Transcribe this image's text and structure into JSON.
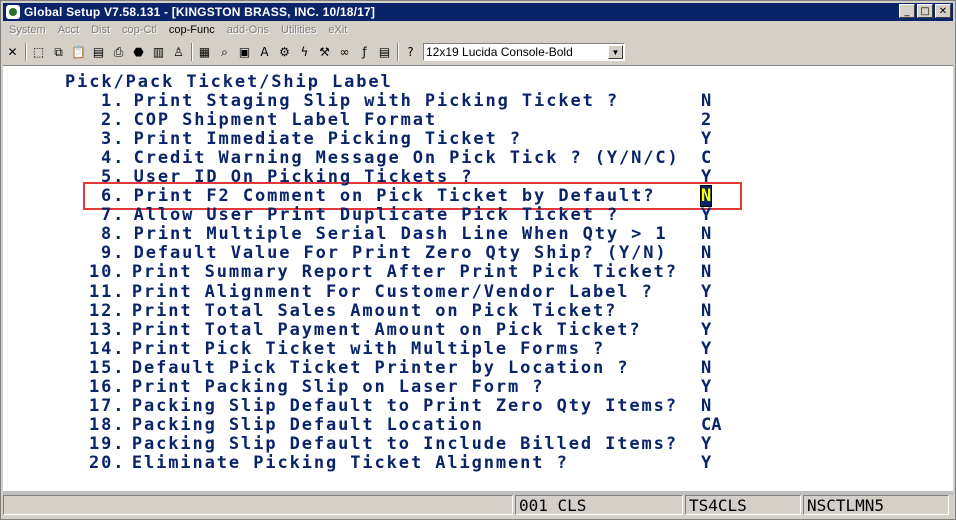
{
  "window": {
    "title": "Global Setup V7.58.131 - [KINGSTON BRASS, INC. 10/18/17]",
    "minimize_glyph": "_",
    "maximize_glyph": "□",
    "close_glyph": "✕"
  },
  "menu": [
    {
      "label": "System",
      "enabled": false
    },
    {
      "label": "Acct",
      "enabled": false
    },
    {
      "label": "Dist",
      "enabled": false
    },
    {
      "label": "cop-Ctl",
      "enabled": false
    },
    {
      "label": "cop-Func",
      "enabled": true
    },
    {
      "label": "add-Ons",
      "enabled": false
    },
    {
      "label": "Utilities",
      "enabled": false
    },
    {
      "label": "eXit",
      "enabled": false
    }
  ],
  "toolbar": {
    "buttons": [
      {
        "icon": "close-icon",
        "glyph": "✕"
      },
      {
        "icon": "select-icon",
        "glyph": "⬚"
      },
      {
        "icon": "copy-icon",
        "glyph": "⧉"
      },
      {
        "icon": "paste-icon",
        "glyph": "📋"
      },
      {
        "icon": "print-icon",
        "glyph": "▤"
      },
      {
        "icon": "printer-setup-icon",
        "glyph": "⎙"
      },
      {
        "icon": "stop-icon",
        "glyph": "⬣"
      },
      {
        "icon": "note-icon",
        "glyph": "▥"
      },
      {
        "icon": "user-icon",
        "glyph": "♙"
      },
      {
        "icon": "print-screen-icon",
        "glyph": "▦"
      },
      {
        "icon": "find-icon",
        "glyph": "⌕"
      },
      {
        "icon": "help-book-icon",
        "glyph": "▣"
      },
      {
        "icon": "font-icon",
        "glyph": "A"
      },
      {
        "icon": "settings-icon",
        "glyph": "⚙"
      },
      {
        "icon": "lightning-icon",
        "glyph": "ϟ"
      },
      {
        "icon": "tools-icon",
        "glyph": "⚒"
      },
      {
        "icon": "link-icon",
        "glyph": "∞"
      },
      {
        "icon": "function-icon",
        "glyph": "ƒ"
      },
      {
        "icon": "document-icon",
        "glyph": "▤"
      },
      {
        "icon": "context-help-icon",
        "glyph": "?"
      }
    ],
    "font_select_value": "12x19 Lucida Console-Bold",
    "font_select_arrow": "▼"
  },
  "screen": {
    "title": "Pick/Pack Ticket/Ship Label",
    "options": [
      {
        "num": "1.",
        "text": "Print Staging Slip with Picking Ticket ?",
        "value": "N"
      },
      {
        "num": "2.",
        "text": "COP Shipment Label Format",
        "value": "2"
      },
      {
        "num": "3.",
        "text": "Print Immediate Picking Ticket ?",
        "value": "Y"
      },
      {
        "num": "4.",
        "text": "Credit Warning Message On Pick Tick ? (Y/N/C)",
        "value": "C"
      },
      {
        "num": "5.",
        "text": "User ID On Picking Tickets ?",
        "value": "Y"
      },
      {
        "num": "6.",
        "text": "Print F2 Comment on Pick Ticket by Default?",
        "value": "N",
        "current": true
      },
      {
        "num": "7.",
        "text": "Allow User Print Duplicate Pick Ticket ?",
        "value": "Y"
      },
      {
        "num": "8.",
        "text": "Print Multiple Serial Dash Line When Qty > 1",
        "value": "N"
      },
      {
        "num": "9.",
        "text": "Default Value For Print Zero Qty Ship? (Y/N)",
        "value": "N"
      },
      {
        "num": "10.",
        "text": "Print Summary Report After Print Pick Ticket?",
        "value": "N"
      },
      {
        "num": "11.",
        "text": "Print Alignment For Customer/Vendor Label ?",
        "value": "Y"
      },
      {
        "num": "12.",
        "text": "Print Total Sales Amount on Pick Ticket?",
        "value": "N"
      },
      {
        "num": "13.",
        "text": "Print Total Payment Amount on Pick Ticket?",
        "value": "Y"
      },
      {
        "num": "14.",
        "text": "Print Pick Ticket with Multiple Forms ?",
        "value": "Y"
      },
      {
        "num": "15.",
        "text": "Default Pick Ticket Printer by Location ?",
        "value": "N"
      },
      {
        "num": "16.",
        "text": "Print Packing Slip on Laser Form ?",
        "value": "Y"
      },
      {
        "num": "17.",
        "text": "Packing Slip Default to Print Zero Qty Items?",
        "value": "N"
      },
      {
        "num": "18.",
        "text": "Packing Slip Default Location",
        "value": "CA"
      },
      {
        "num": "19.",
        "text": "Packing Slip Default to Include Billed Items?",
        "value": "Y"
      },
      {
        "num": "20.",
        "text": "Eliminate Picking Ticket Alignment ?",
        "value": "Y"
      }
    ]
  },
  "status": [
    {
      "text": "",
      "name": "status-message-field"
    },
    {
      "text": "001 CLS",
      "name": "status-company-field"
    },
    {
      "text": "TS4CLS",
      "name": "status-terminal-field"
    },
    {
      "text": "NSCTLMN5",
      "name": "status-program-field"
    }
  ],
  "colors": {
    "terminal_text": "#0a246a",
    "highlight_box": "#e23a3a",
    "current_field_fg": "#ffff00"
  }
}
